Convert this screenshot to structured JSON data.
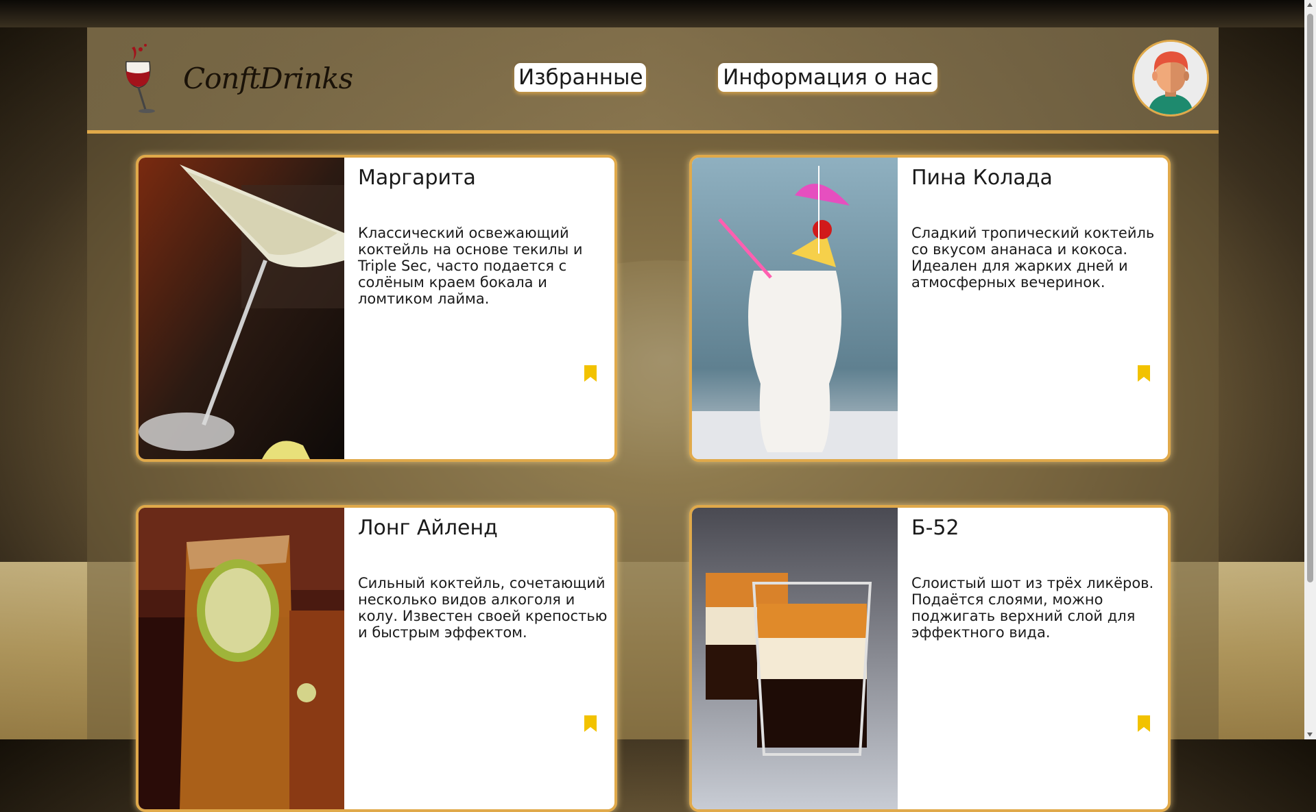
{
  "app": {
    "logo_text": "ConftDrinks"
  },
  "nav": {
    "favorites_label": "Избранные",
    "about_label": "Информация о нас"
  },
  "colors": {
    "accent": "#e0a94a",
    "bookmark": "#f2c200",
    "card_bg": "#ffffff"
  },
  "cards": [
    {
      "title": "Маргарита",
      "description": "Классический освежающий коктейль на основе текилы и Triple Sec, часто подается с солёным краем бокала и ломтиком лайма.",
      "photo": "margarita-photo"
    },
    {
      "title": "Пина Колада",
      "description": "Сладкий тропический коктейль со вкусом ананаса и кокоса. Идеален для жарких дней и атмосферных вечеринок.",
      "photo": "pina-colada-photo"
    },
    {
      "title": "Лонг Айленд",
      "description": "Сильный коктейль, сочетающий несколько видов алкоголя и колу. Известен своей крепостью и быстрым эффектом.",
      "photo": "long-island-photo"
    },
    {
      "title": "Б-52",
      "description": "Слоистый шот из трёх ликёров. Подаётся слоями, можно поджигать верхний слой для эффектного вида.",
      "photo": "b52-photo"
    }
  ]
}
